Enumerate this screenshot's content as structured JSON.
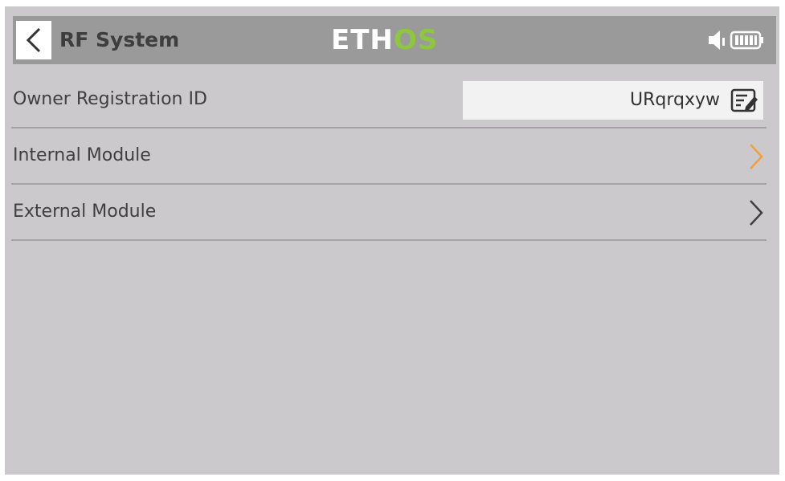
{
  "header": {
    "title": "RF System",
    "logo_main": "ETH",
    "logo_accent": "OS"
  },
  "rows": [
    {
      "label": "Owner Registration ID",
      "value": "URqrqxyw",
      "icon": "edit-icon"
    },
    {
      "label": "Internal Module",
      "icon": "chevron-right-icon",
      "chevron_color": "#f0a040"
    },
    {
      "label": "External Module",
      "icon": "chevron-right-icon",
      "chevron_color": "#404040"
    }
  ],
  "colors": {
    "screen_bg": "#cbc9cb",
    "header_bg": "#9a9a9a",
    "logo_accent": "#8fc63f",
    "focus_accent": "#f0a040"
  }
}
